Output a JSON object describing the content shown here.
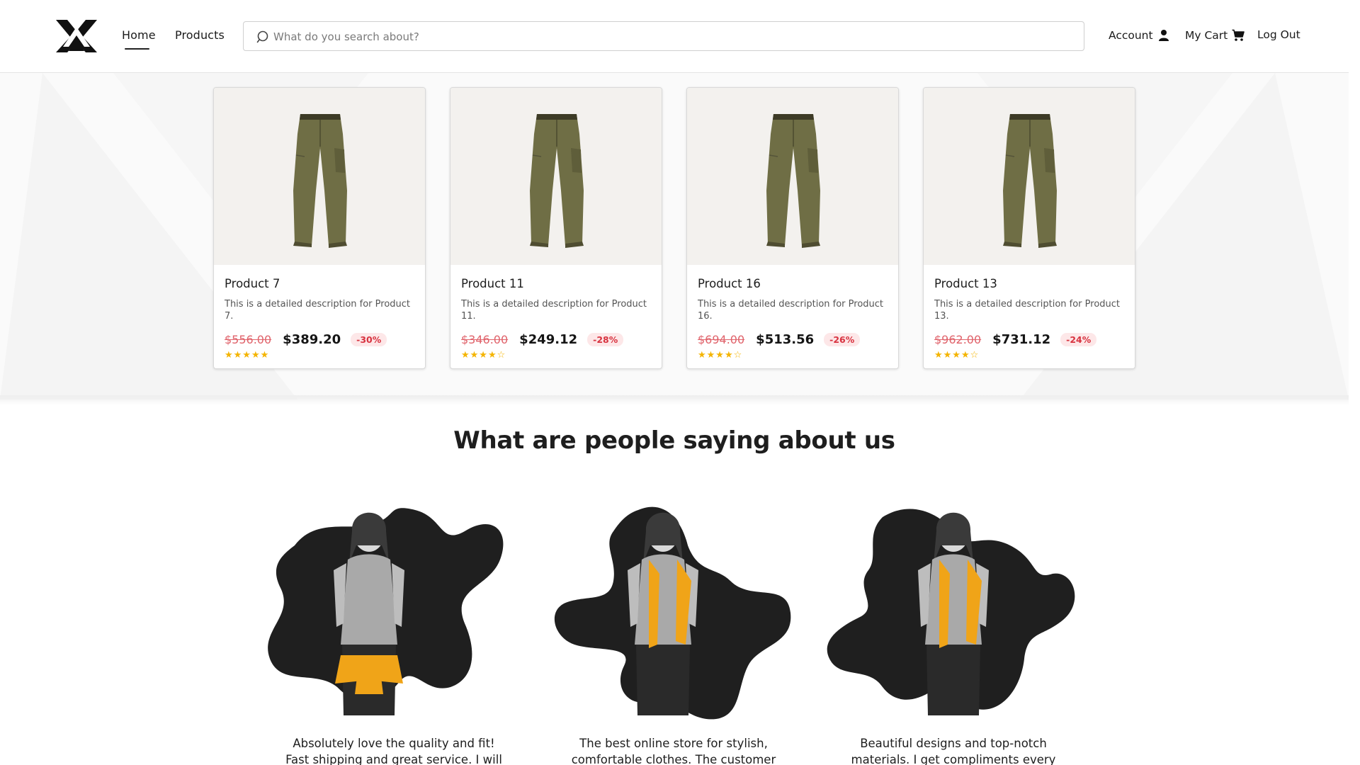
{
  "header": {
    "nav": [
      {
        "label": "Home",
        "active": true
      },
      {
        "label": "Products",
        "active": false
      }
    ],
    "search": {
      "placeholder": "What do you search about?",
      "value": ""
    },
    "account_label": "Account",
    "cart_label": "My Cart",
    "logout_label": "Log Out",
    "icons": {
      "search": "search-icon",
      "account": "user-icon",
      "cart": "cart-icon"
    }
  },
  "products": [
    {
      "title": "Product 7",
      "description": "This is a detailed description for Product 7.",
      "old_price": "$556.00",
      "new_price": "$389.20",
      "discount": "-30%",
      "rating": 5,
      "stars": "★★★★★"
    },
    {
      "title": "Product 11",
      "description": "This is a detailed description for Product 11.",
      "old_price": "$346.00",
      "new_price": "$249.12",
      "discount": "-28%",
      "rating": 4,
      "stars": "★★★★☆"
    },
    {
      "title": "Product 16",
      "description": "This is a detailed description for Product 16.",
      "old_price": "$694.00",
      "new_price": "$513.56",
      "discount": "-26%",
      "rating": 4,
      "stars": "★★★★☆"
    },
    {
      "title": "Product 13",
      "description": "This is a detailed description for Product 13.",
      "old_price": "$962.00",
      "new_price": "$731.12",
      "discount": "-24%",
      "rating": 4,
      "stars": "★★★★☆"
    }
  ],
  "testimonials_section": {
    "title": "What are people saying about us",
    "items": [
      {
        "line1": "Absolutely love the quality and fit!",
        "line2": "Fast shipping and great service. I will"
      },
      {
        "line1": "The best online store for stylish,",
        "line2": "comfortable clothes. The customer"
      },
      {
        "line1": "Beautiful designs and top-notch",
        "line2": "materials. I get compliments every"
      }
    ]
  },
  "colors": {
    "text": "#1e1e1e",
    "old_price": "#e0636b",
    "discount_text": "#d83340",
    "discount_bg": "#fde7e8",
    "stars": "#f4b400",
    "accent_yellow": "#f0a418",
    "blob": "#1f1f1f",
    "product_bg": "#f3f1ee",
    "pants": "#6f6e45"
  }
}
